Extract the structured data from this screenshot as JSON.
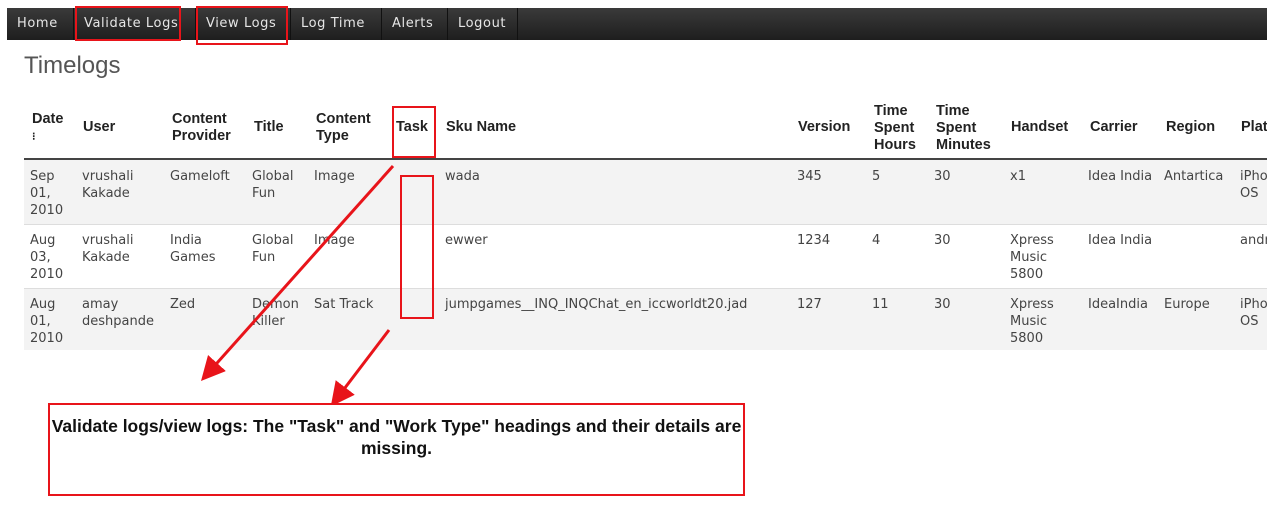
{
  "nav": {
    "items": [
      "Home",
      "Validate Logs",
      "View Logs",
      "Log Time",
      "Alerts",
      "Logout"
    ]
  },
  "page": {
    "title": "Timelogs"
  },
  "table": {
    "headers": {
      "date": "Date",
      "user": "User",
      "content_provider": "Content Provider",
      "title": "Title",
      "content_type": "Content Type",
      "task": "Task",
      "sku_name": "Sku Name",
      "version": "Version",
      "time_spent_hours": "Time Spent Hours",
      "time_spent_minutes": "Time Spent Minutes",
      "handset": "Handset",
      "carrier": "Carrier",
      "region": "Region",
      "platform": "Plat"
    },
    "rows": [
      {
        "date": "Sep 01, 2010",
        "user": "vrushali Kakade",
        "content_provider": "Gameloft",
        "title": "Global Fun",
        "content_type": "Image",
        "task": "",
        "sku_name": "wada",
        "version": "345",
        "hours": "5",
        "minutes": "30",
        "handset": "x1",
        "carrier": "Idea India",
        "region": "Antartica",
        "platform": "iPho OS"
      },
      {
        "date": "Aug 03, 2010",
        "user": "vrushali Kakade",
        "content_provider": "India Games",
        "title": "Global Fun",
        "content_type": "Image",
        "task": "",
        "sku_name": "ewwer",
        "version": "1234",
        "hours": "4",
        "minutes": "30",
        "handset": "Xpress Music 5800",
        "carrier": "Idea India",
        "region": "",
        "platform": "andr"
      },
      {
        "date": "Aug 01, 2010",
        "user": "amay deshpande",
        "content_provider": "Zed",
        "title": "Demon Killer",
        "content_type": "Sat Track",
        "task": "",
        "sku_name": "jumpgames__INQ_INQChat_en_iccworldt20.jad",
        "version": "127",
        "hours": "11",
        "minutes": "30",
        "handset": "Xpress Music 5800",
        "carrier": "IdeaIndia",
        "region": "Europe",
        "platform": "iPho OS"
      }
    ]
  },
  "annotation": {
    "text": "Validate logs/view logs: The \"Task\" and \"Work Type\" headings and their details are missing.",
    "color": "#e8141a"
  }
}
